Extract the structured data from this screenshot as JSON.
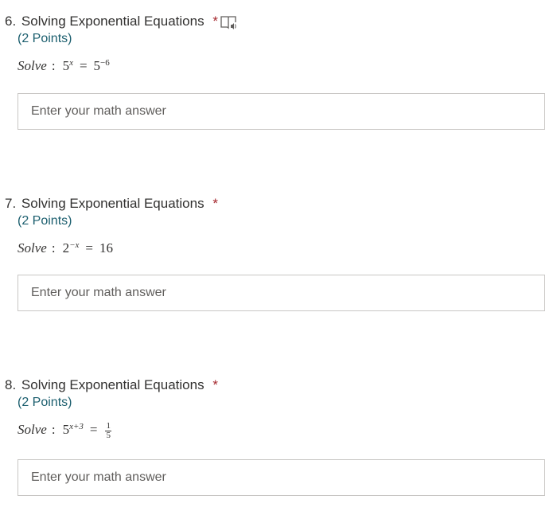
{
  "questions": [
    {
      "number": "6.",
      "title": "Solving Exponential Equations",
      "required_mark": "*",
      "points": "(2 Points)",
      "has_reader_icon": true,
      "math": {
        "prefix": "Solve",
        "colon": ":",
        "base": "5",
        "exp": "x",
        "eq": "=",
        "rhs_base": "5",
        "rhs_exp": "−6"
      },
      "answer_placeholder": "Enter your math answer"
    },
    {
      "number": "7.",
      "title": "Solving Exponential Equations",
      "required_mark": "*",
      "points": "(2 Points)",
      "math": {
        "prefix": "Solve",
        "colon": ":",
        "base": "2",
        "exp": "−x",
        "eq": "=",
        "rhs": "16"
      },
      "answer_placeholder": "Enter your math answer"
    },
    {
      "number": "8.",
      "title": "Solving Exponential Equations",
      "required_mark": "*",
      "points": "(2 Points)",
      "math": {
        "prefix": "Solve",
        "colon": ":",
        "base": "5",
        "exp": "x+3",
        "eq": "=",
        "frac_num": "1",
        "frac_den": "5"
      },
      "answer_placeholder": "Enter your math answer"
    }
  ],
  "icons": {
    "reader": "immersive-reader-icon"
  },
  "colors": {
    "required": "#a4262c",
    "points": "#1b5e6e",
    "border": "#c8c6c4"
  }
}
